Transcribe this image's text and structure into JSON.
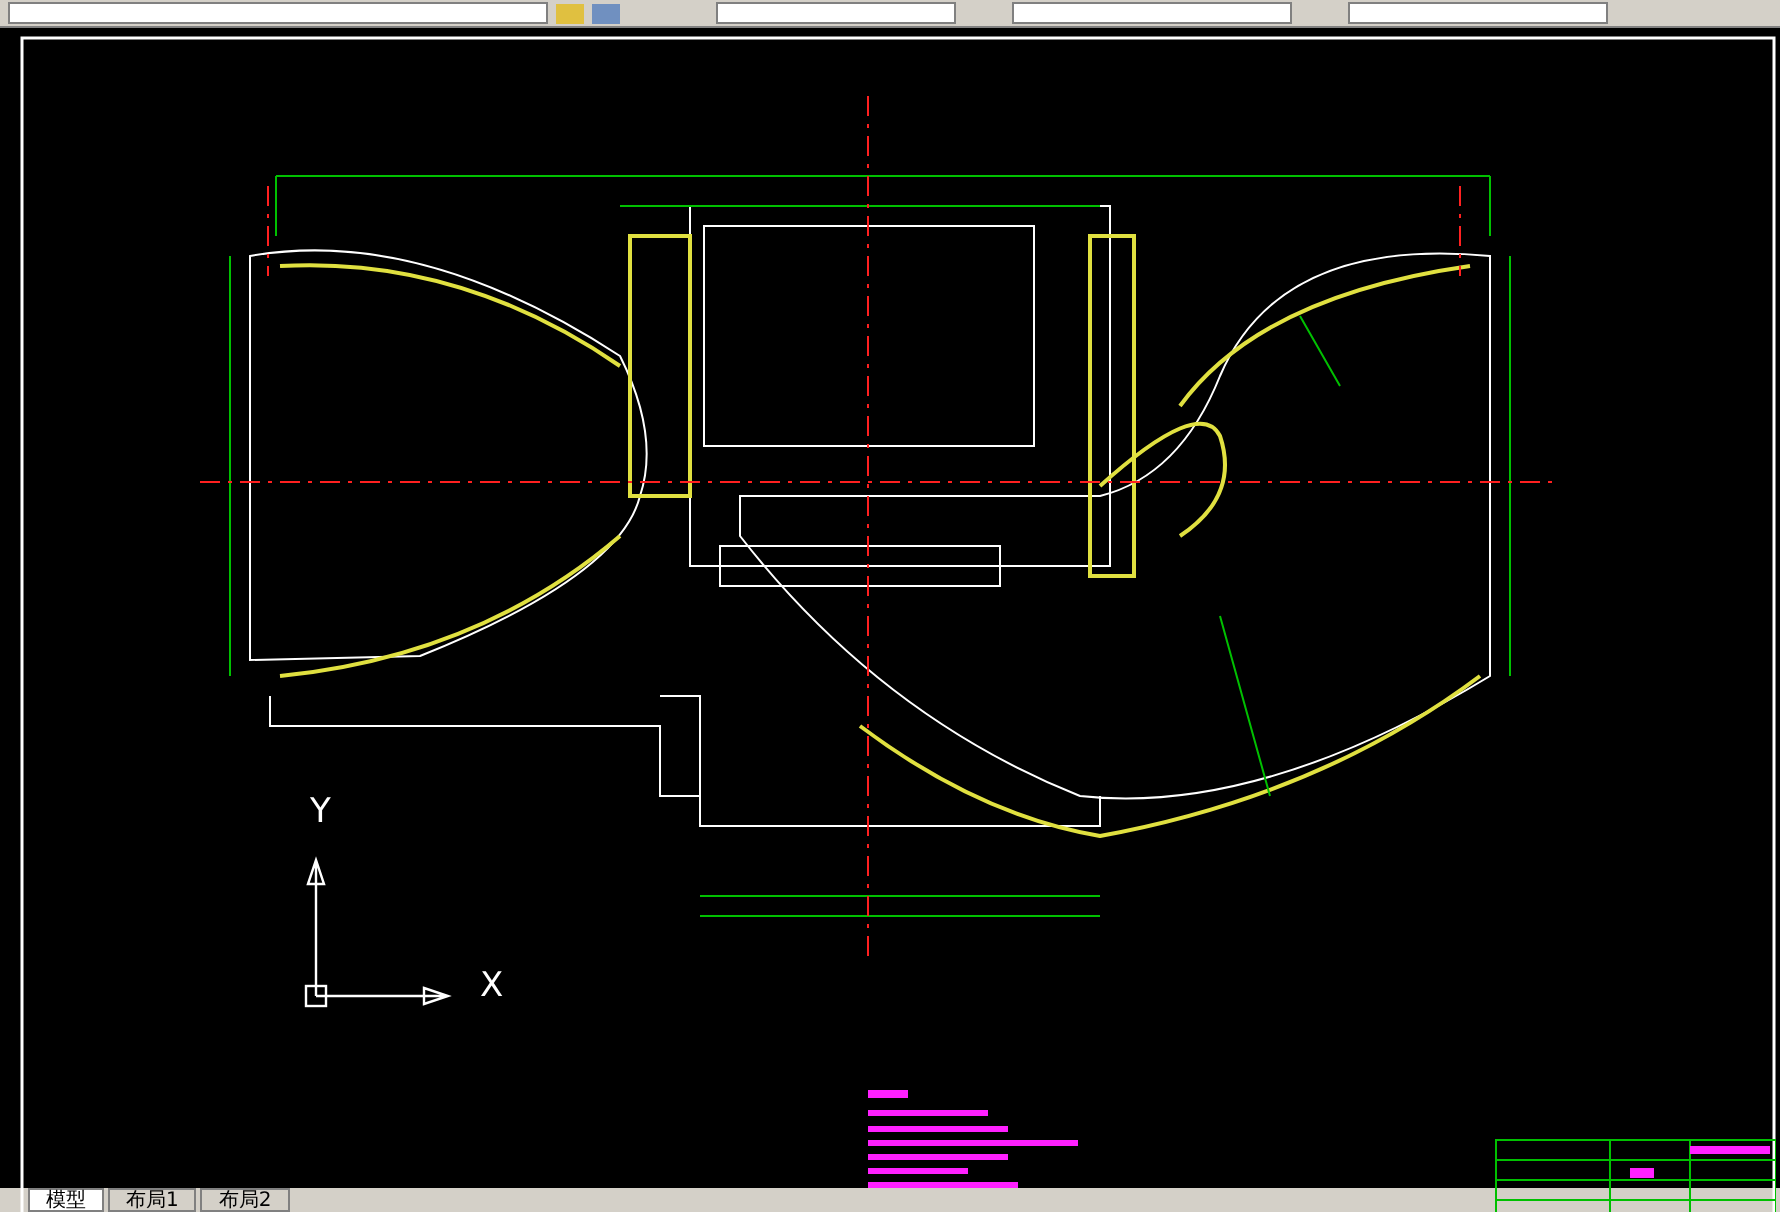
{
  "ucs": {
    "x_label": "X",
    "y_label": "Y"
  },
  "layout_tabs": [
    {
      "label": "模型",
      "selected": true
    },
    {
      "label": "布局1",
      "selected": false
    },
    {
      "label": "布局2",
      "selected": false
    }
  ]
}
